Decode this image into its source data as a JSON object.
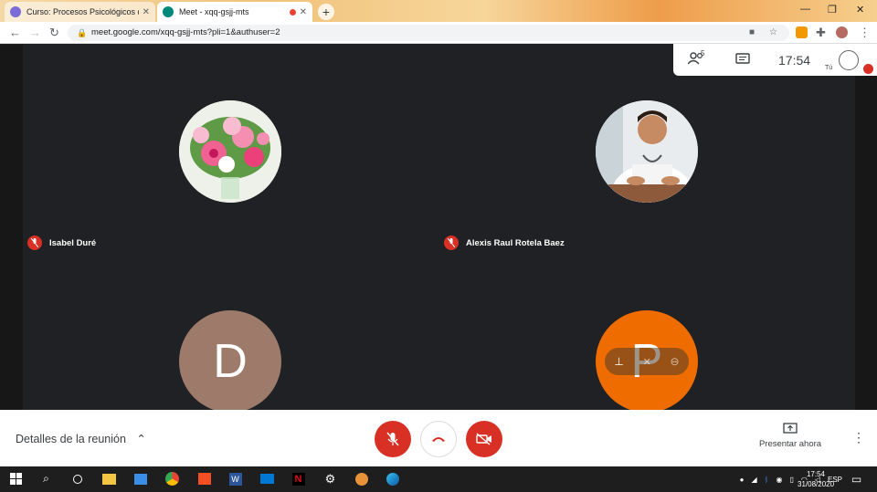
{
  "browser": {
    "tabs": [
      {
        "title": "Curso: Procesos Psicológicos que",
        "active": false
      },
      {
        "title": "Meet - xqq-gsjj-mts",
        "active": true,
        "recording": true
      }
    ],
    "url": "meet.google.com/xqq-gsjj-mts?pli=1&authuser=2"
  },
  "meet": {
    "header": {
      "participants_count": "5",
      "time": "17:54",
      "self_label": "Tú"
    },
    "tiles": [
      {
        "name": "Isabel Duré",
        "avatar_type": "flowers-photo",
        "mic": "off"
      },
      {
        "name": "Alexis Raul Rotela Baez",
        "avatar_type": "person-photo",
        "mic": "off"
      },
      {
        "initial": "D",
        "avatar_color": "#9e7a6b"
      },
      {
        "initial": "P",
        "avatar_color": "#ef6c00"
      }
    ],
    "controls": {
      "details_label": "Detalles de la reunión",
      "present_label": "Presentar ahora"
    },
    "colors": {
      "danger": "#d93025",
      "stage": "#202124"
    }
  },
  "taskbar": {
    "language": "ESP",
    "time": "17:54",
    "date": "31/08/2020"
  }
}
